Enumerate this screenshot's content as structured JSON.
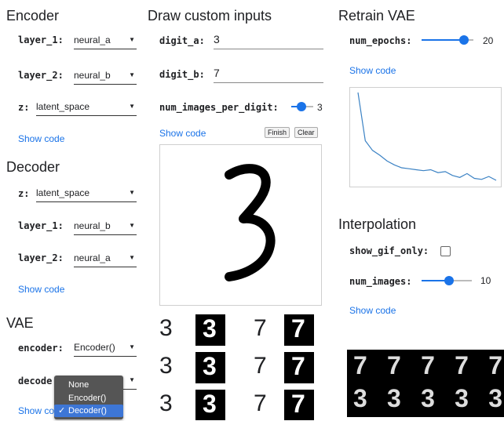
{
  "encoder": {
    "heading": "Encoder",
    "rows": [
      {
        "label": "layer_1:",
        "value": "neural_a"
      },
      {
        "label": "layer_2:",
        "value": "neural_b"
      },
      {
        "label": "z:",
        "value": "latent_space"
      }
    ],
    "show_code": "Show code"
  },
  "decoder": {
    "heading": "Decoder",
    "rows": [
      {
        "label": "z:",
        "value": "latent_space"
      },
      {
        "label": "layer_1:",
        "value": "neural_b"
      },
      {
        "label": "layer_2:",
        "value": "neural_a"
      }
    ],
    "show_code": "Show code"
  },
  "vae": {
    "heading": "VAE",
    "encoder_label": "encoder:",
    "encoder_value": "Encoder()",
    "decoder_label": "decoder:",
    "decoder_label_visible": "decode",
    "show_code_visible": "Show co",
    "dropdown_options": [
      "None",
      "Encoder()",
      "Decoder()"
    ],
    "dropdown_selected": "Decoder()",
    "check_mark": "✓"
  },
  "draw": {
    "heading": "Draw custom inputs",
    "digit_a_label": "digit_a:",
    "digit_a_value": "3",
    "digit_b_label": "digit_b:",
    "digit_b_value": "7",
    "num_images_label": "num_images_per_digit:",
    "num_images_value": "3",
    "num_images_fraction": 0.45,
    "show_code": "Show code",
    "finish_label": "Finish",
    "clear_label": "Clear",
    "drawn_digit": "3",
    "samples": [
      {
        "drawn": "3",
        "recon": "3"
      },
      {
        "drawn": "7",
        "recon": "7"
      },
      {
        "drawn": "3",
        "recon": "3"
      },
      {
        "drawn": "7",
        "recon": "7"
      },
      {
        "drawn": "3",
        "recon": "3"
      },
      {
        "drawn": "7",
        "recon": "7"
      }
    ]
  },
  "retrain": {
    "heading": "Retrain VAE",
    "epochs_label": "num_epochs:",
    "epochs_value": "20",
    "epochs_fraction": 0.88,
    "show_code": "Show code",
    "loss_curve": [
      1.0,
      0.5,
      0.4,
      0.35,
      0.29,
      0.25,
      0.22,
      0.21,
      0.2,
      0.19,
      0.2,
      0.17,
      0.18,
      0.14,
      0.12,
      0.16,
      0.11,
      0.1,
      0.13,
      0.09
    ]
  },
  "interpolation": {
    "heading": "Interpolation",
    "gif_label": "show_gif_only:",
    "gif_checked": false,
    "images_label": "num_images:",
    "images_value": "10",
    "images_fraction": 0.55,
    "show_code": "Show code",
    "strip_top": [
      "7",
      "7",
      "7",
      "7",
      "7"
    ],
    "strip_bottom": [
      "3",
      "3",
      "3",
      "3",
      "3"
    ]
  },
  "colors": {
    "accent": "#1a73e8",
    "menu_bg": "#555555",
    "menu_selected": "#3d76d6",
    "line": "#3b82c4"
  }
}
